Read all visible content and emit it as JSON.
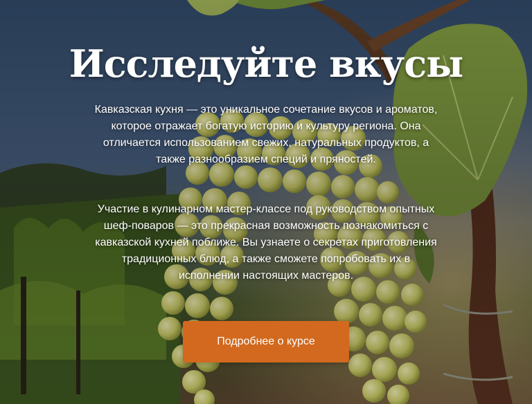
{
  "hero": {
    "title": "Исследуйте вкусы",
    "paragraph_1": "Кавказская кухня — это уникальное сочетание вкусов и ароматов, которое отражает богатую историю и культуру региона. Она отличается использованием свежих, натуральных продуктов, а также разнообразием специй и пряностей.",
    "paragraph_2": "Участие в кулинарном мастер-классе под руководством опытных шеф-поваров — это прекрасная возможность познакомиться с кавказской кухней поближе. Вы узнаете о секретах приготовления традиционных блюд, а также сможете попробовать их в исполнении настоящих мастеров.",
    "cta_label": "Подробнее о курсе"
  },
  "colors": {
    "cta_background": "#d2691e",
    "text": "#ffffff",
    "sky": "#3e5a7a",
    "grapes": "#d8d87a",
    "leaf": "#8aa048"
  },
  "background": {
    "image_subject": "vineyard-grape-cluster-photo"
  }
}
